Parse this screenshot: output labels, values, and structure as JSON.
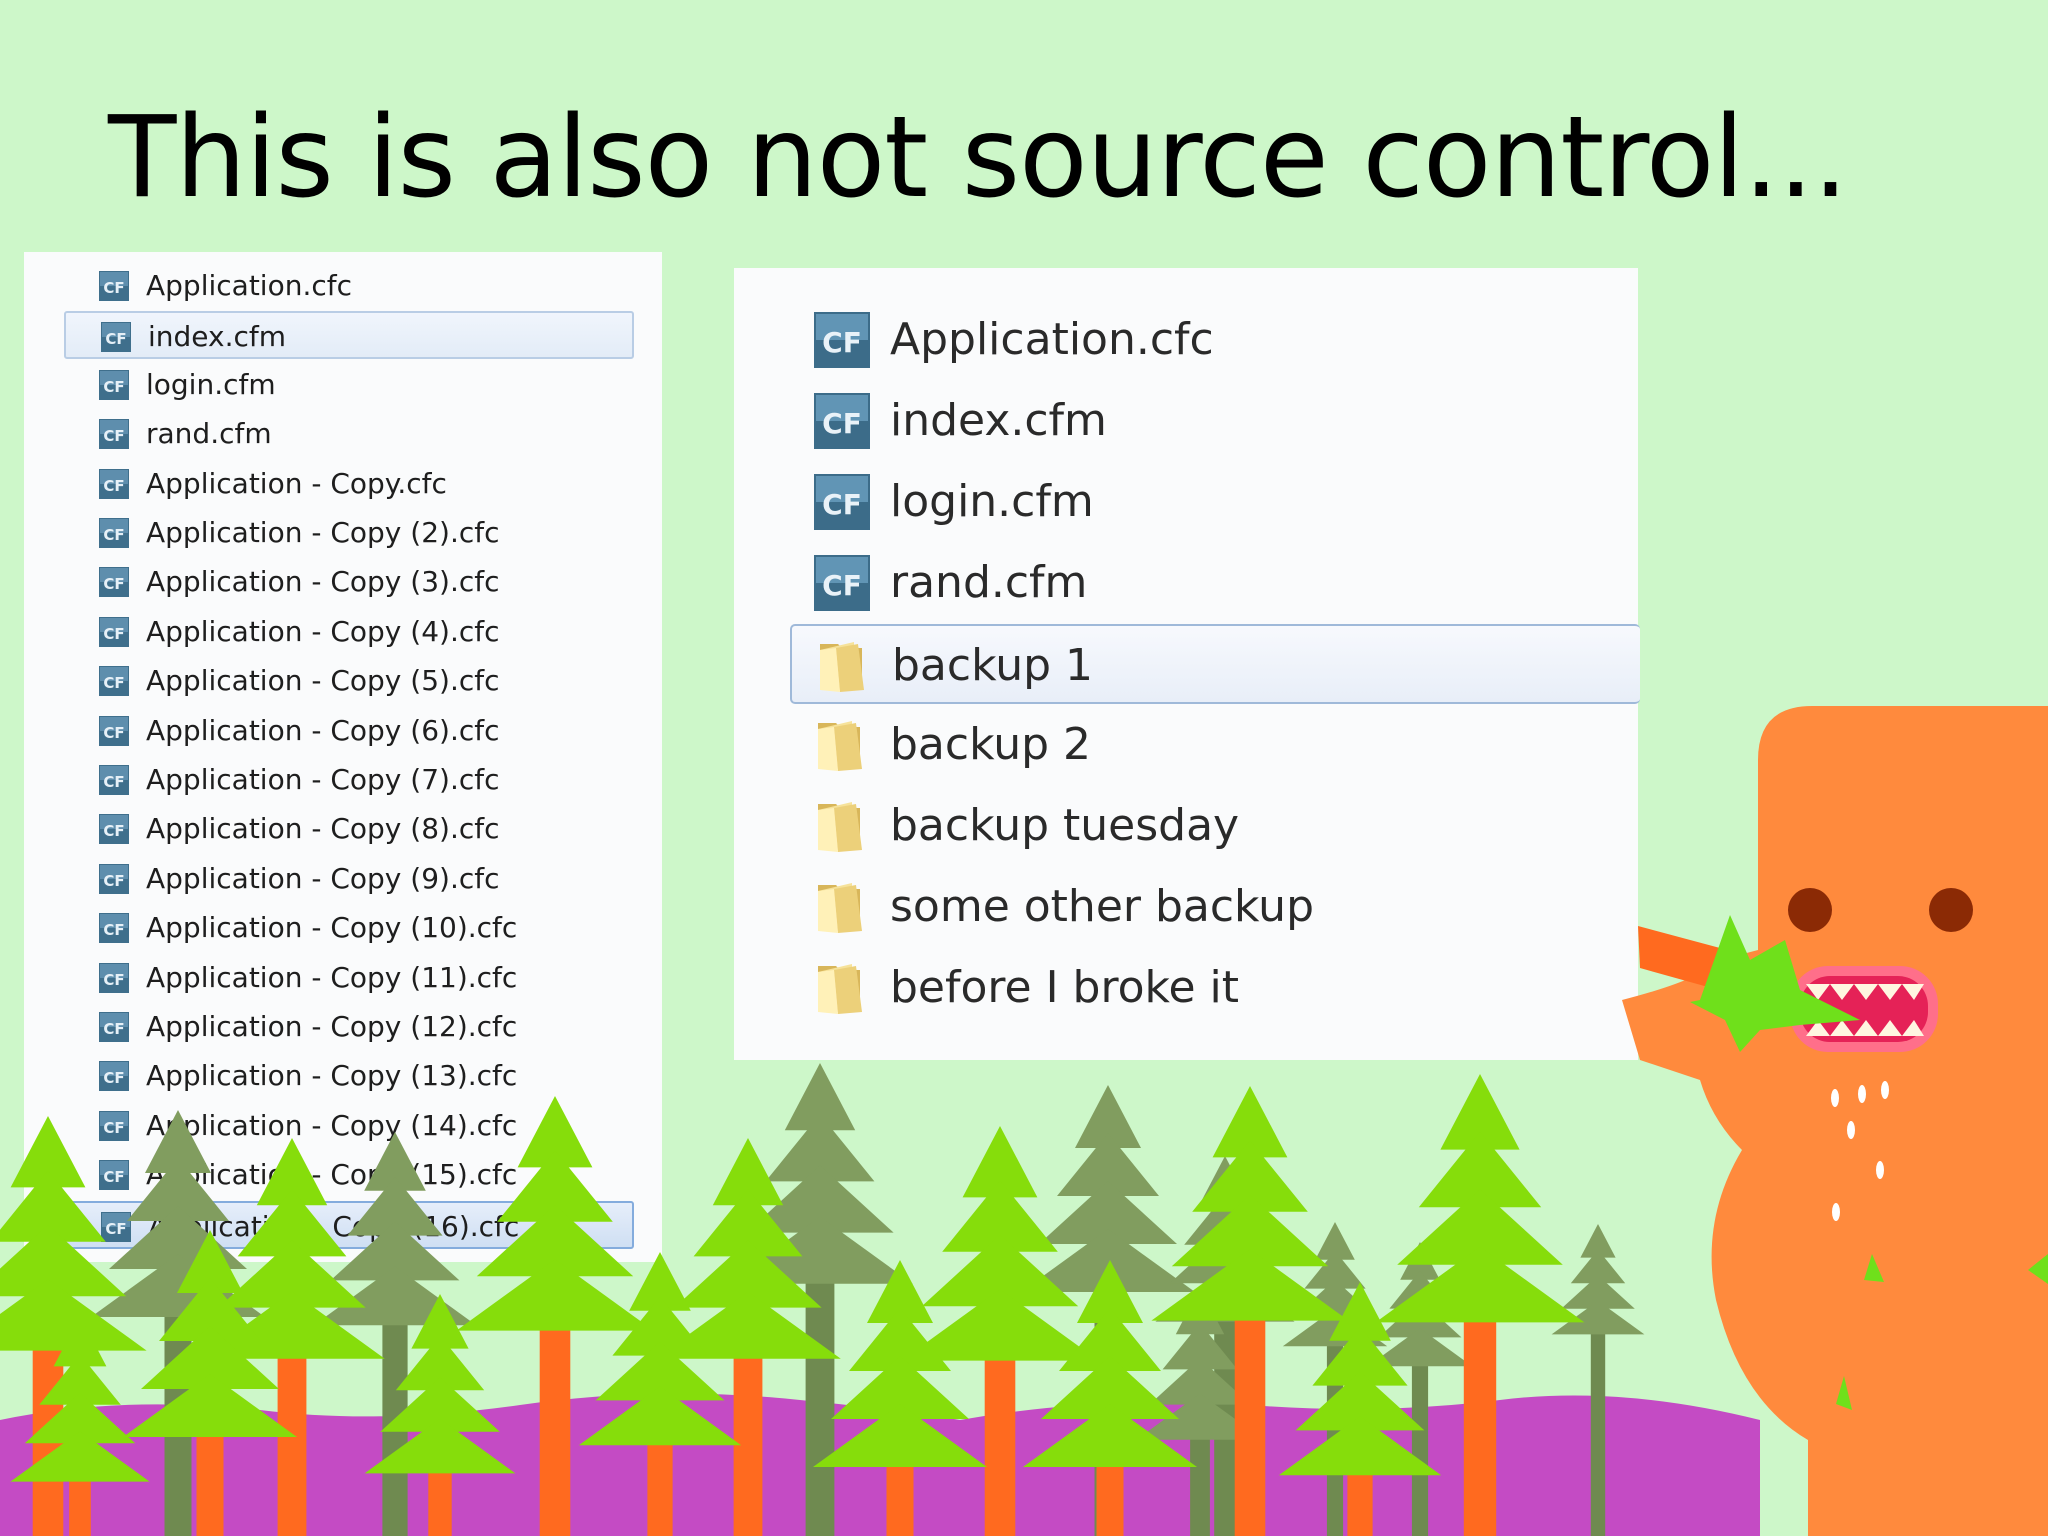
{
  "slide": {
    "title": "This is also not source control..."
  },
  "left_list": {
    "files": [
      "Application.cfc",
      "index.cfm",
      "login.cfm",
      "rand.cfm",
      "Application - Copy.cfc",
      "Application - Copy (2).cfc",
      "Application - Copy (3).cfc",
      "Application - Copy (4).cfc",
      "Application - Copy (5).cfc",
      "Application - Copy (6).cfc",
      "Application - Copy (7).cfc",
      "Application - Copy (8).cfc",
      "Application - Copy (9).cfc",
      "Application - Copy (10).cfc",
      "Application - Copy (11).cfc",
      "Application - Copy (12).cfc",
      "Application - Copy (13).cfc",
      "Application - Copy (14).cfc",
      "Application - Copy (15).cfc",
      "Application - Copy (16).cfc"
    ],
    "icon": "coldfusion-file-icon",
    "icon_text": "CF"
  },
  "right_list": {
    "items": [
      {
        "name": "Application.cfc",
        "icon": "coldfusion-file-icon"
      },
      {
        "name": "index.cfm",
        "icon": "coldfusion-file-icon"
      },
      {
        "name": "login.cfm",
        "icon": "coldfusion-file-icon"
      },
      {
        "name": "rand.cfm",
        "icon": "coldfusion-file-icon"
      },
      {
        "name": "backup 1",
        "icon": "folder-icon"
      },
      {
        "name": "backup 2",
        "icon": "folder-icon"
      },
      {
        "name": "backup tuesday",
        "icon": "folder-icon"
      },
      {
        "name": "some other backup",
        "icon": "folder-icon"
      },
      {
        "name": "before I broke it",
        "icon": "folder-icon"
      }
    ]
  },
  "colors": {
    "background": "#cdf7c9",
    "monster": "#ff8a3d",
    "hills": "#c44bc4",
    "tree_bright": "#86dd0b",
    "tree_olive": "#819d5f",
    "trunk": "#ff6a1f"
  }
}
